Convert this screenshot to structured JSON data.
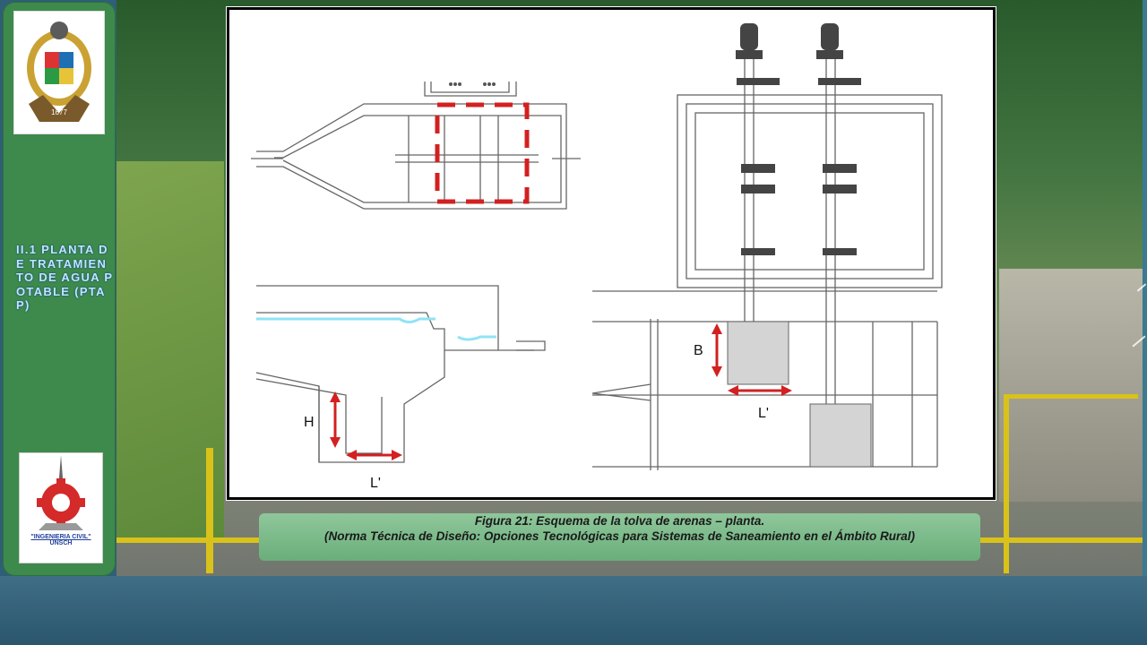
{
  "sidebar": {
    "section_title": "II.1 PLANTA DE TRATAMIENTO DE AGUA POTABLE (PTAP)",
    "bottom_logo_line1": "\"INGENIERIA CIVIL\"",
    "bottom_logo_line2": "UNSCH",
    "top_logo_year": "1677"
  },
  "figure": {
    "label_B": "B",
    "label_L_right": "L'",
    "label_H": "H",
    "label_L_bottom": "L'"
  },
  "caption": {
    "line1": "Figura 21: Esquema de la tolva de arenas – planta.",
    "line2": "(Norma Técnica de Diseño: Opciones Tecnológicas para Sistemas de Saneamiento en el Ámbito Rural)"
  },
  "colors": {
    "sidebar_green": "#3d8a4c",
    "title_blue": "#bfe6ff",
    "caption_green": "#7dbb8a",
    "dimension_red": "#d32020",
    "water_cyan": "#8fe3f5"
  }
}
